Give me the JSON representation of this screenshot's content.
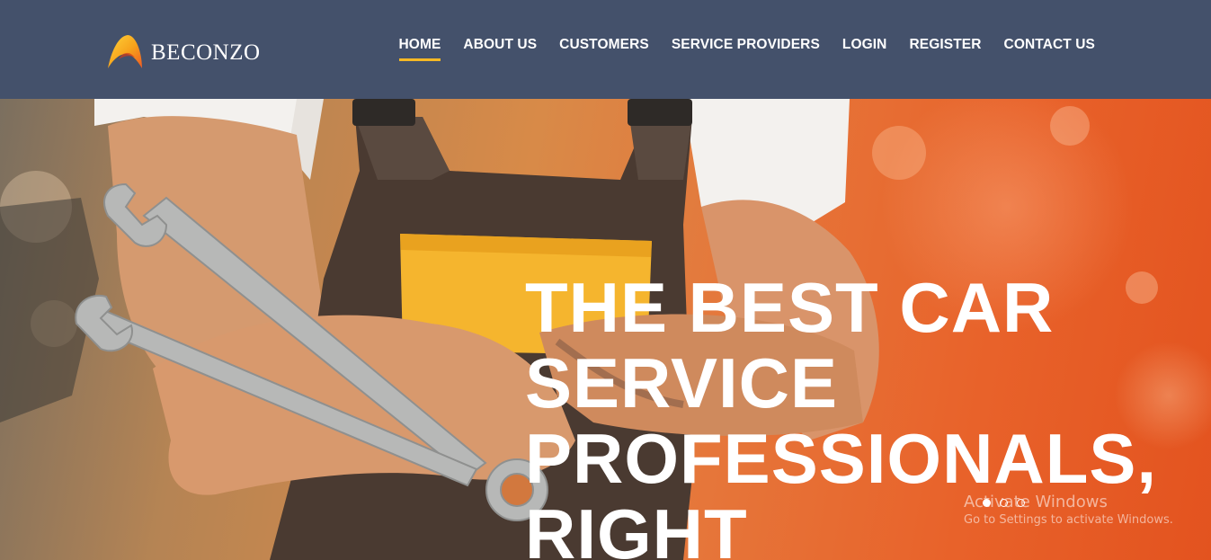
{
  "brand": {
    "name": "BECONZO",
    "colors": {
      "header_bg": "#44516b",
      "accent": "#f5b825",
      "hero_orange": "#e8622a"
    }
  },
  "nav": {
    "items": [
      {
        "label": "HOME",
        "active": true
      },
      {
        "label": "ABOUT US"
      },
      {
        "label": "CUSTOMERS"
      },
      {
        "label": "SERVICE PROVIDERS"
      },
      {
        "label": "LOGIN"
      },
      {
        "label": "REGISTER"
      },
      {
        "label": "CONTACT US"
      }
    ]
  },
  "hero": {
    "title_lines": [
      "THE BEST CAR",
      "SERVICE",
      "PROFESSIONALS,",
      "RIGHT"
    ],
    "image": "mechanic-with-wrenches-photo",
    "slides": {
      "count": 3,
      "active_index": 0
    }
  },
  "os_overlay": {
    "title": "Activate Windows",
    "subtitle": "Go to Settings to activate Windows."
  }
}
